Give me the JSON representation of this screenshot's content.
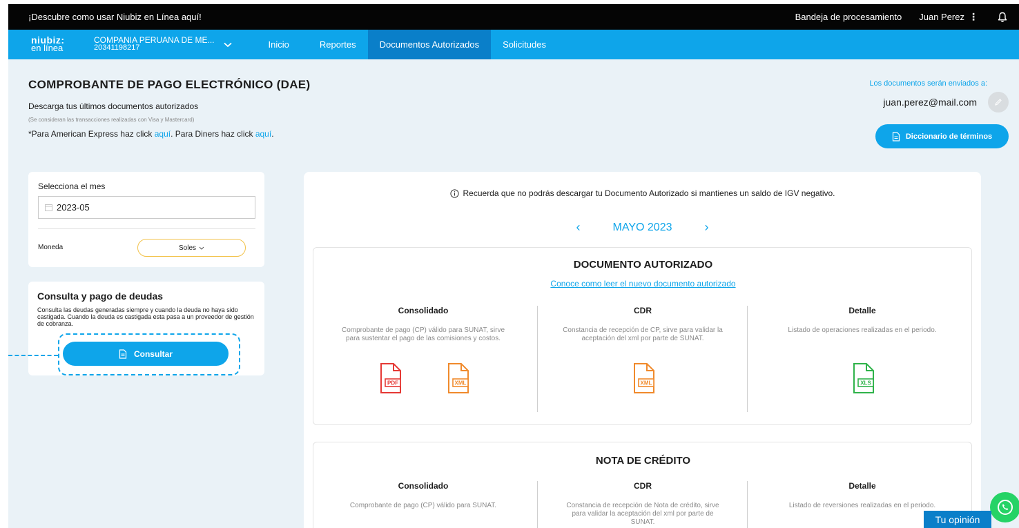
{
  "topbar": {
    "promo": "¡Descubre como usar Niubiz en Línea aquí!",
    "tray": "Bandeja de procesamiento",
    "user": "Juan Perez",
    "kebab": "⋮"
  },
  "nav": {
    "logo_line1": "niubiz:",
    "logo_line2": "en línea",
    "company_name": "COMPANIA PERUANA DE ME...",
    "company_ruc": "20341198217",
    "items": [
      "Inicio",
      "Reportes",
      "Documentos Autorizados",
      "Solicitudes"
    ],
    "active_item": "Documentos Autorizados"
  },
  "header": {
    "title": "COMPROBANTE DE PAGO ELECTRÓNICO (DAE)",
    "subtitle": "Descarga tus últimos documentos autorizados",
    "note": "(Se consideran las transacciones realizadas con Visa y Mastercard)",
    "links_part1": "*Para American Express haz click ",
    "link1": "aquí",
    "links_part2": ". Para Diners haz click ",
    "link2": "aquí",
    "links_part3": ".",
    "send_label": "Los documentos serán enviados a:",
    "email": "juan.perez@mail.com",
    "dict_button": "Diccionario de términos"
  },
  "filter": {
    "month_label": "Selecciona el mes",
    "month_value": "2023-05",
    "currency_label": "Moneda",
    "currency_value": "Soles"
  },
  "debt": {
    "title": "Consulta y pago de deudas",
    "text": "Consulta las deudas generadas siempre y cuando la deuda no haya sido castigada. Cuando la deuda es castigada esta pasa a un proveedor de gestión de cobranza.",
    "button": "Consultar"
  },
  "panel": {
    "notice": "Recuerda que no podrás descargar tu Documento Autorizado si mantienes un saldo de IGV negativo.",
    "month": "MAYO 2023",
    "doc1": {
      "title": "DOCUMENTO AUTORIZADO",
      "link": "Conoce como leer el nuevo documento autorizado",
      "cols": [
        {
          "title": "Consolidado",
          "desc": "Comprobante de pago (CP) válido para SUNAT, sirve para sustentar el pago de las comisiones y costos."
        },
        {
          "title": "CDR",
          "desc": "Constancia de recepción de CP, sirve para validar la aceptación del xml por parte de SUNAT."
        },
        {
          "title": "Detalle",
          "desc": "Listado de operaciones realizadas en el periodo."
        }
      ],
      "icons": {
        "pdf": "PDF",
        "xml": "XML",
        "xls": "XLS"
      }
    },
    "doc2": {
      "title": "NOTA DE CRÉDITO",
      "cols": [
        {
          "title": "Consolidado",
          "desc": "Comprobante de pago (CP) válido para SUNAT."
        },
        {
          "title": "CDR",
          "desc": "Constancia de recepción de Nota de crédito, sirve para validar la aceptación del xml por parte de SUNAT."
        },
        {
          "title": "Detalle",
          "desc": "Listado de reversiones realizadas en el periodo."
        }
      ]
    }
  },
  "widgets": {
    "feedback": "Tu opinión",
    "whatsapp_icon": "whatsapp-icon"
  },
  "colors": {
    "brand_blue": "#0ea5ea",
    "active_blue": "#0a7fc9",
    "pdf_red": "#e53935",
    "xml_orange": "#f08a2c",
    "xls_green": "#2fb34a",
    "select_border": "#f2c24a"
  }
}
